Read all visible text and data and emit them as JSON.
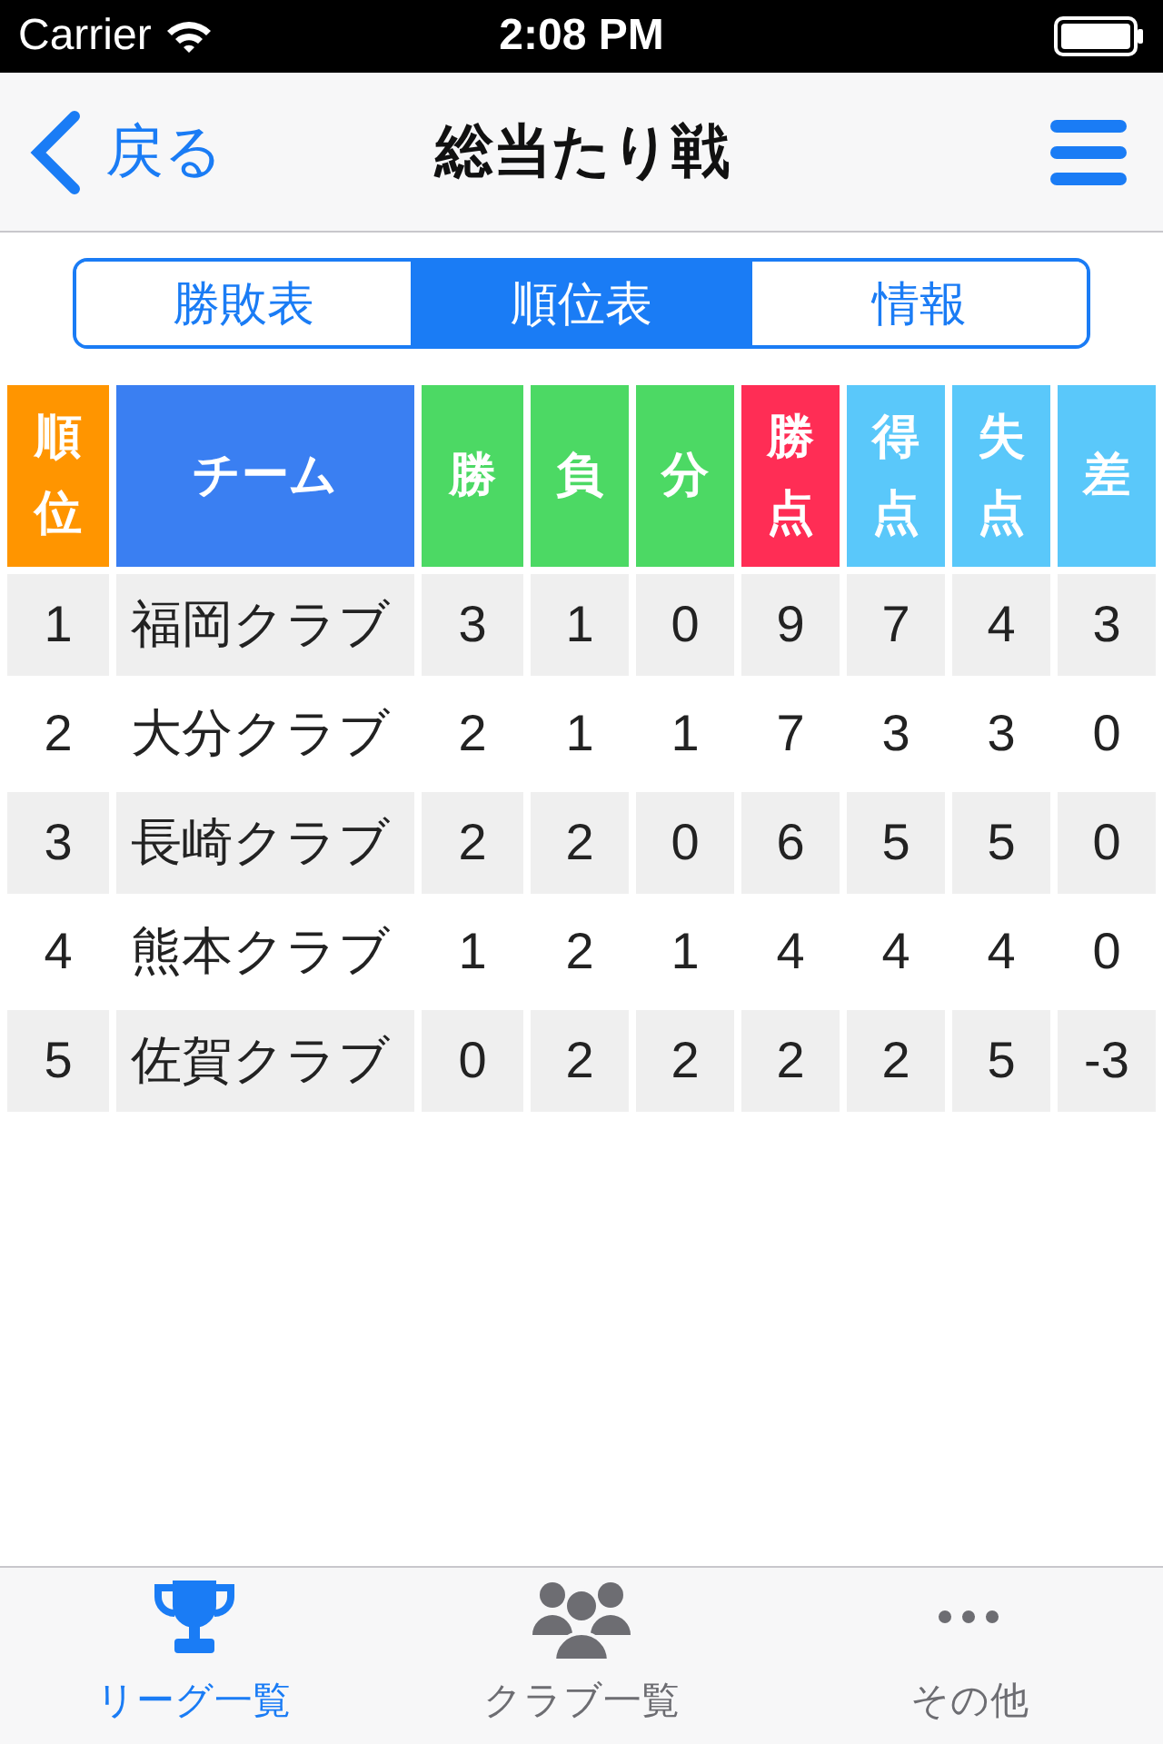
{
  "status_bar": {
    "carrier": "Carrier",
    "time": "2:08 PM"
  },
  "nav_bar": {
    "back": "戻る",
    "title": "総当たり戦"
  },
  "segments": [
    {
      "label": "勝敗表",
      "selected": false
    },
    {
      "label": "順位表",
      "selected": true
    },
    {
      "label": "情報",
      "selected": false
    }
  ],
  "table": {
    "columns": [
      {
        "label": "順位",
        "color": "#ff9500"
      },
      {
        "label": "チーム",
        "color": "#3a7ff2"
      },
      {
        "label": "勝",
        "color": "#4cd964"
      },
      {
        "label": "負",
        "color": "#4cd964"
      },
      {
        "label": "分",
        "color": "#4cd964"
      },
      {
        "label": "勝点",
        "color": "#ff2d55"
      },
      {
        "label": "得点",
        "color": "#5ac8fa"
      },
      {
        "label": "失点",
        "color": "#5ac8fa"
      },
      {
        "label": "差",
        "color": "#5ac8fa"
      }
    ],
    "rows": [
      [
        "1",
        "福岡クラブ",
        "3",
        "1",
        "0",
        "9",
        "7",
        "4",
        "3"
      ],
      [
        "2",
        "大分クラブ",
        "2",
        "1",
        "1",
        "7",
        "3",
        "3",
        "0"
      ],
      [
        "3",
        "長崎クラブ",
        "2",
        "2",
        "0",
        "6",
        "5",
        "5",
        "0"
      ],
      [
        "4",
        "熊本クラブ",
        "1",
        "2",
        "1",
        "4",
        "4",
        "4",
        "0"
      ],
      [
        "5",
        "佐賀クラブ",
        "0",
        "2",
        "2",
        "2",
        "2",
        "5",
        "-3"
      ]
    ]
  },
  "tab_bar": [
    {
      "kind": "trophy",
      "label": "リーグ一覧",
      "selected": true
    },
    {
      "kind": "people",
      "label": "クラブ一覧",
      "selected": false
    },
    {
      "kind": "more",
      "label": "その他",
      "selected": false
    }
  ]
}
